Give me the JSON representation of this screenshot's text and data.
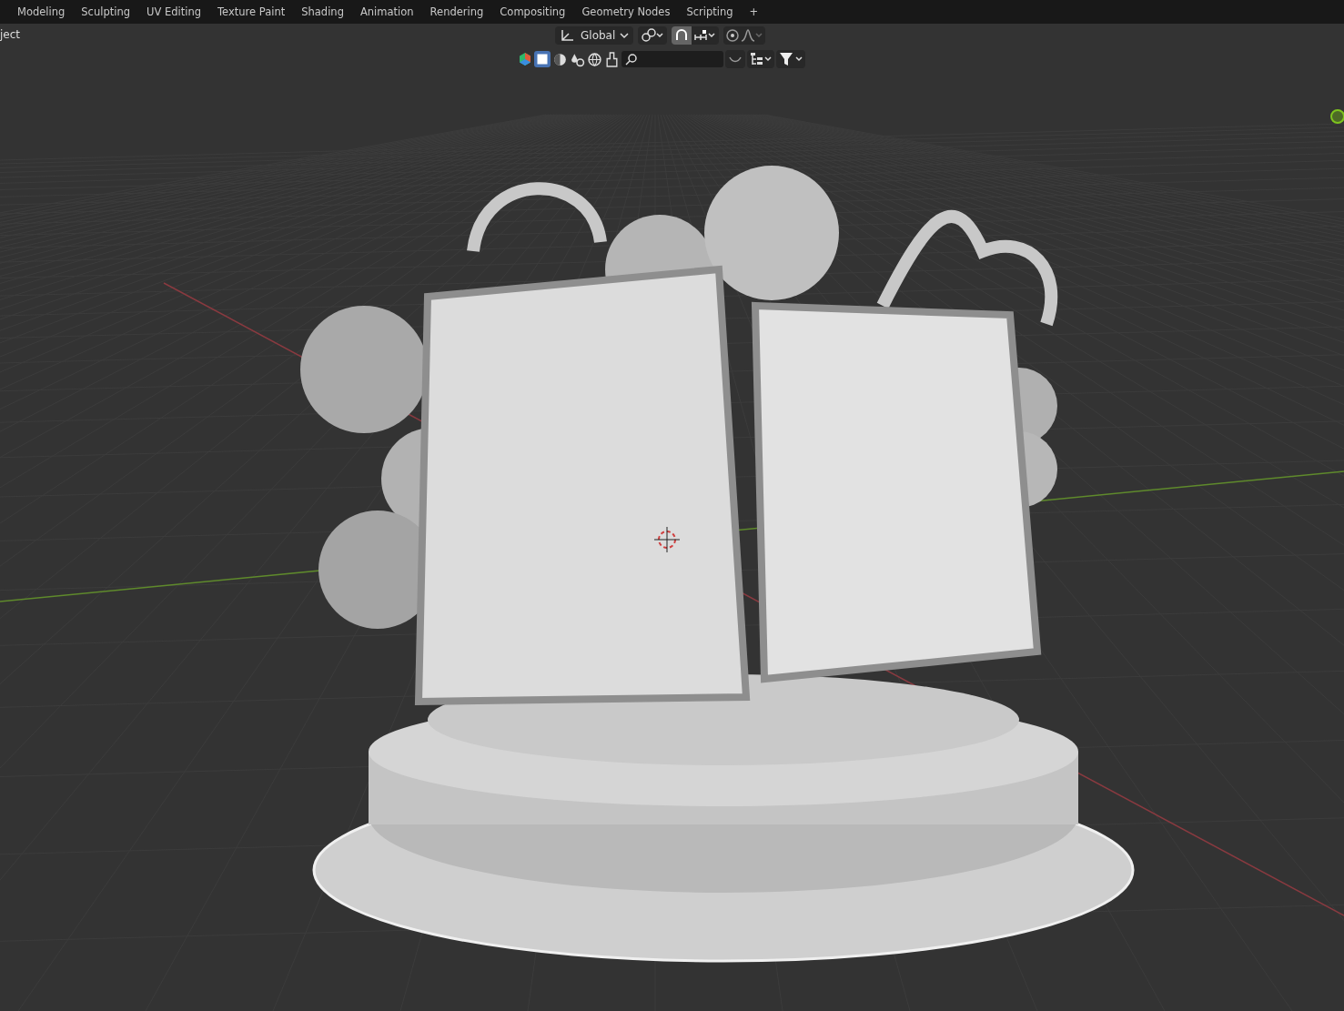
{
  "workspace_tabs": [
    {
      "label": "Modeling"
    },
    {
      "label": "Sculpting"
    },
    {
      "label": "UV Editing"
    },
    {
      "label": "Texture Paint"
    },
    {
      "label": "Shading"
    },
    {
      "label": "Animation"
    },
    {
      "label": "Rendering"
    },
    {
      "label": "Compositing"
    },
    {
      "label": "Geometry Nodes"
    },
    {
      "label": "Scripting"
    },
    {
      "label": "+"
    }
  ],
  "viewport": {
    "mode_label": "ject",
    "header": {
      "orientation": "Global",
      "snap_on": true,
      "proportional_on": false
    },
    "filter_bar": {
      "selectable_on": true
    }
  }
}
